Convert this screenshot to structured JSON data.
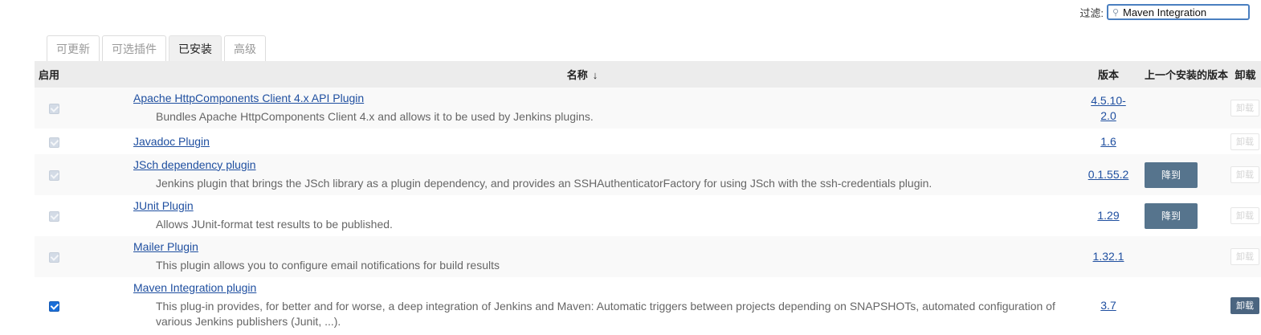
{
  "filter": {
    "label": "过滤:",
    "value": "Maven Integration"
  },
  "tabs": [
    {
      "label": "可更新",
      "active": false
    },
    {
      "label": "可选插件",
      "active": false
    },
    {
      "label": "已安装",
      "active": true
    },
    {
      "label": "高级",
      "active": false
    }
  ],
  "table": {
    "headers": {
      "enable": "启用",
      "name": "名称",
      "sort_indicator": "↓",
      "version": "版本",
      "previous": "上一个安装的版本",
      "uninstall": "卸载"
    },
    "rows": [
      {
        "name": "Apache HttpComponents Client 4.x API Plugin",
        "description": "Bundles Apache HttpComponents Client 4.x and allows it to be used by Jenkins plugins.",
        "version": "4.5.10-2.0",
        "downgrade": "",
        "uninstall": "卸载",
        "enabled": true,
        "can_disable": false,
        "can_uninstall": false
      },
      {
        "name": "Javadoc Plugin",
        "description": "",
        "version": "1.6",
        "downgrade": "",
        "uninstall": "卸载",
        "enabled": true,
        "can_disable": false,
        "can_uninstall": false
      },
      {
        "name": "JSch dependency plugin",
        "description": "Jenkins plugin that brings the JSch library as a plugin dependency, and provides an SSHAuthenticatorFactory for using JSch with the ssh-credentials plugin.",
        "version": "0.1.55.2",
        "downgrade": "降到",
        "uninstall": "卸载",
        "enabled": true,
        "can_disable": false,
        "can_uninstall": false
      },
      {
        "name": "JUnit Plugin",
        "description": "Allows JUnit-format test results to be published.",
        "version": "1.29",
        "downgrade": "降到",
        "uninstall": "卸载",
        "enabled": true,
        "can_disable": false,
        "can_uninstall": false
      },
      {
        "name": "Mailer Plugin",
        "description": "This plugin allows you to configure email notifications for build results",
        "version": "1.32.1",
        "downgrade": "",
        "uninstall": "卸载",
        "enabled": true,
        "can_disable": false,
        "can_uninstall": false
      },
      {
        "name": "Maven Integration plugin",
        "description": "This plug-in provides, for better and for worse, a deep integration of Jenkins and Maven: Automatic triggers between projects depending on SNAPSHOTs, automated configuration of various Jenkins publishers (Junit, ...).",
        "version": "3.7",
        "downgrade": "",
        "uninstall": "卸载",
        "enabled": true,
        "can_disable": true,
        "can_uninstall": true
      }
    ]
  }
}
